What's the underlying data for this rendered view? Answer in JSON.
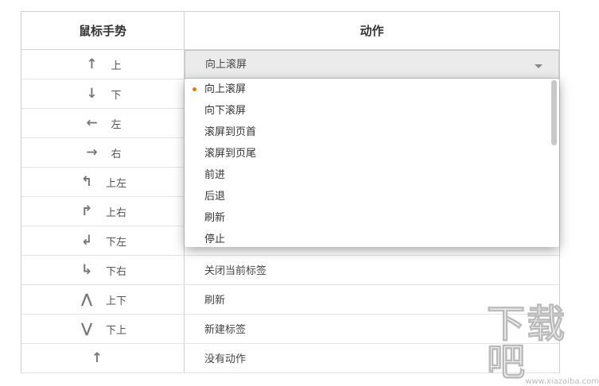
{
  "header": {
    "gesture": "鼠标手势",
    "action": "动作"
  },
  "rows": [
    {
      "icon": "↑",
      "gesture": "上",
      "action": "向上滚屏"
    },
    {
      "icon": "↓",
      "gesture": "下",
      "action": ""
    },
    {
      "icon": "←",
      "gesture": "左",
      "action": ""
    },
    {
      "icon": "→",
      "gesture": "右",
      "action": ""
    },
    {
      "icon": "↰",
      "gesture": "上左",
      "action": ""
    },
    {
      "icon": "↱",
      "gesture": "上右",
      "action": ""
    },
    {
      "icon": "↲",
      "gesture": "下左",
      "action": ""
    },
    {
      "icon": "↳",
      "gesture": "下右",
      "action": "关闭当前标签"
    },
    {
      "icon": "⋀",
      "gesture": "上下",
      "action": "刷新"
    },
    {
      "icon": "⋁",
      "gesture": "下上",
      "action": "新建标签"
    },
    {
      "icon": "↑",
      "gesture": "",
      "action": "没有动作"
    }
  ],
  "dropdown": {
    "selected": "向上滚屏",
    "options": [
      "向上滚屏",
      "向下滚屏",
      "滚屏到页首",
      "滚屏到页尾",
      "前进",
      "后退",
      "刷新",
      "停止"
    ],
    "accent": "#e07b1a"
  },
  "watermark": {
    "logo": "下载吧",
    "url": "www.xiazaiba.com"
  }
}
